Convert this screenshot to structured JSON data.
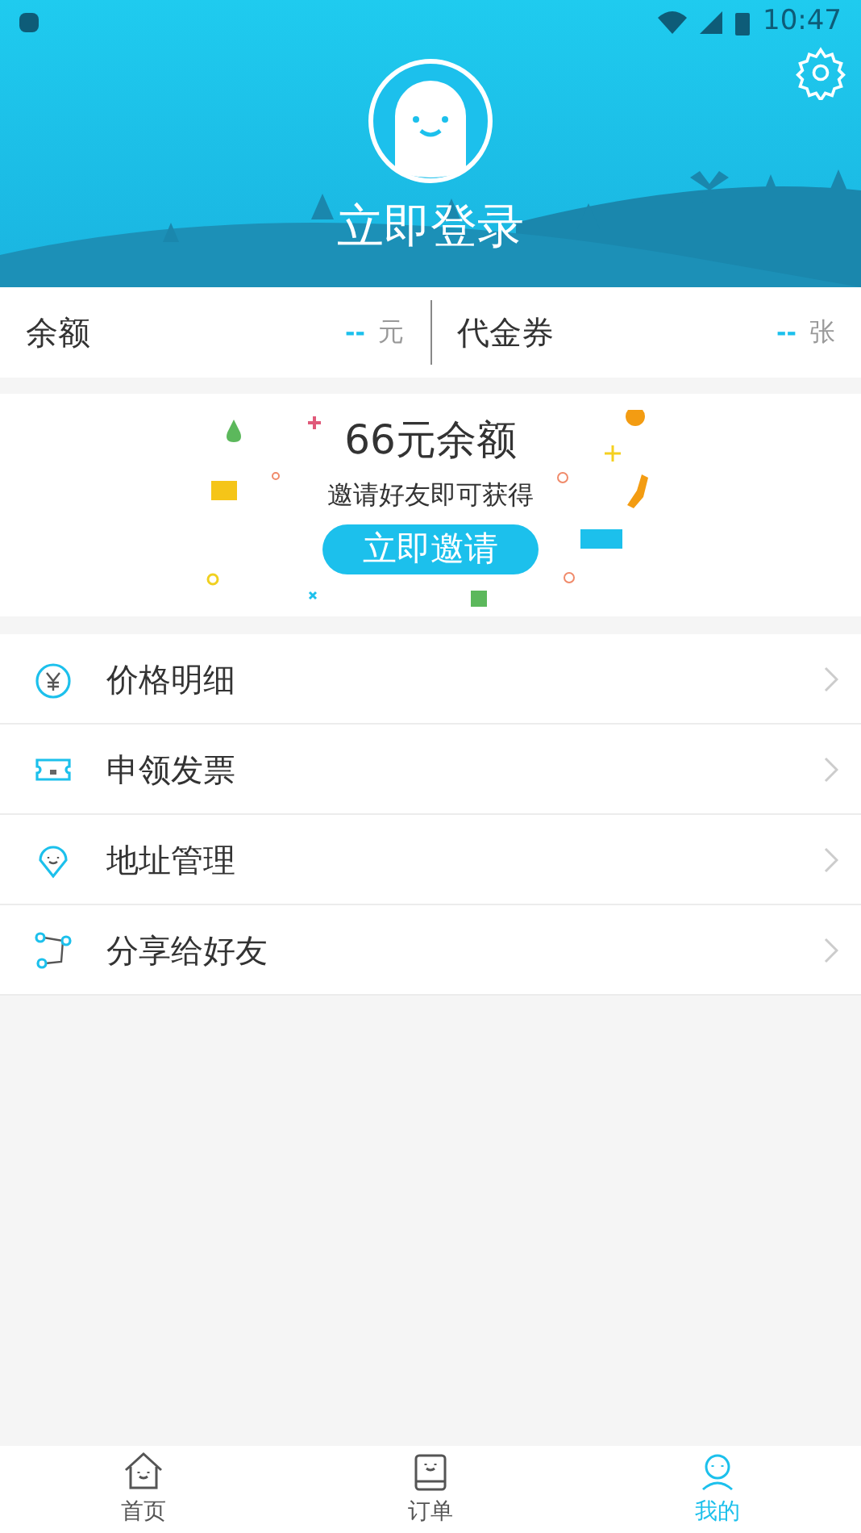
{
  "status_bar": {
    "time": "10:47"
  },
  "header": {
    "login": "立即登录"
  },
  "summary": [
    {
      "label": "余额",
      "value": "--",
      "unit": "元"
    },
    {
      "label": "代金券",
      "value": "--",
      "unit": "张"
    }
  ],
  "invite": {
    "title": "66元余额",
    "subtitle": "邀请好友即可获得",
    "button": "立即邀请"
  },
  "menu": [
    {
      "label": "价格明细",
      "kind": "price"
    },
    {
      "label": "申领发票",
      "kind": "invoice"
    },
    {
      "label": "地址管理",
      "kind": "address"
    },
    {
      "label": "分享给好友",
      "kind": "share"
    }
  ],
  "tabs": [
    {
      "label": "首页",
      "kind": "home",
      "selected": false
    },
    {
      "label": "订单",
      "kind": "order",
      "selected": false
    },
    {
      "label": "我的",
      "kind": "me",
      "selected": true
    }
  ]
}
